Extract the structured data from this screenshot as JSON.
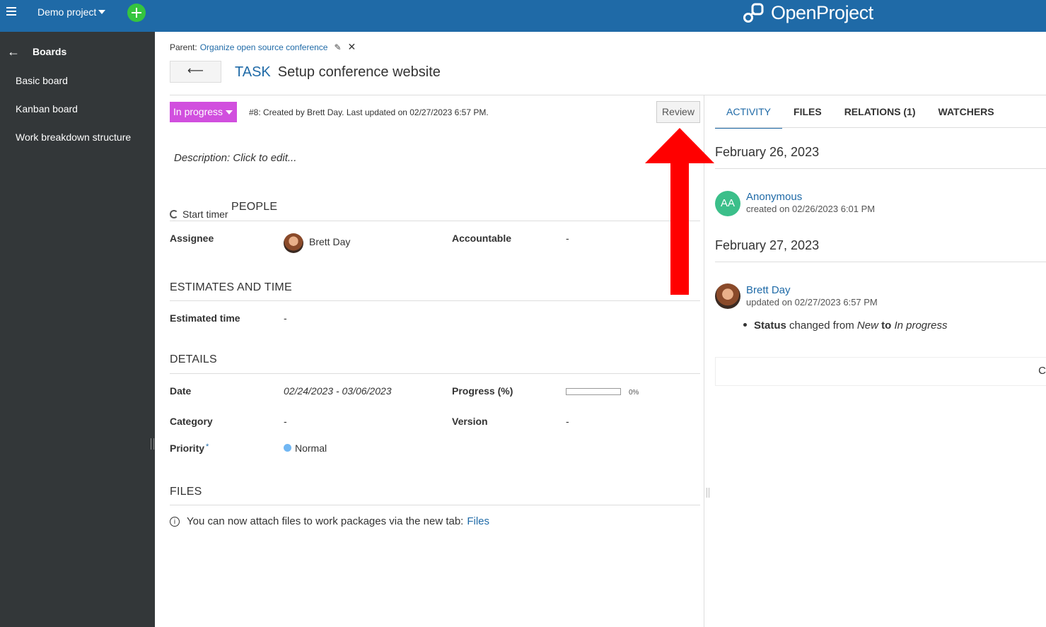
{
  "header": {
    "project_name": "Demo project",
    "logo_text": "OpenProject",
    "accent": "#1f6aa7",
    "plus_color": "#35c53f"
  },
  "sidebar": {
    "back_label": "Boards",
    "items": [
      {
        "label": "Basic board"
      },
      {
        "label": "Kanban board"
      },
      {
        "label": "Work breakdown structure"
      }
    ]
  },
  "work_package": {
    "parent_label": "Parent:",
    "parent_link": "Organize open source conference",
    "type": "TASK",
    "subject": "Setup conference website",
    "status": "In progress",
    "status_color": "#d14fde",
    "meta": "#8: Created by Brett Day. Last updated on 02/27/2023 6:57 PM.",
    "review_label": "Review",
    "description_placeholder": "Description: Click to edit...",
    "start_timer": "Start timer"
  },
  "sections": {
    "people": {
      "title": "PEOPLE",
      "assignee_label": "Assignee",
      "assignee_value": "Brett Day",
      "accountable_label": "Accountable",
      "accountable_value": "-"
    },
    "estimates": {
      "title": "ESTIMATES AND TIME",
      "estimated_label": "Estimated time",
      "estimated_value": "-"
    },
    "details": {
      "title": "DETAILS",
      "date_label": "Date",
      "date_value": "02/24/2023 - 03/06/2023",
      "progress_label": "Progress (%)",
      "progress_value": 0,
      "progress_text": "0%",
      "category_label": "Category",
      "category_value": "-",
      "version_label": "Version",
      "version_value": "-",
      "priority_label": "Priority",
      "priority_required": "*",
      "priority_value": "Normal",
      "priority_color": "#71b7f3"
    },
    "files": {
      "title": "FILES",
      "info_text": "You can now attach files to work packages via the new tab:",
      "files_link": "Files"
    }
  },
  "activity": {
    "tabs": [
      {
        "label": "ACTIVITY"
      },
      {
        "label": "FILES"
      },
      {
        "label": "RELATIONS (1)"
      },
      {
        "label": "WATCHERS"
      }
    ],
    "groups": [
      {
        "date": "February 26, 2023",
        "entries": [
          {
            "initials": "AA",
            "name": "Anonymous",
            "sub": "created on 02/26/2023 6:01 PM"
          }
        ]
      },
      {
        "date": "February 27, 2023",
        "entries": [
          {
            "name": "Brett Day",
            "sub": "updated on 02/27/2023 6:57 PM",
            "detail_field": "Status",
            "detail_changed": "changed from",
            "detail_from": "New",
            "detail_to_word": "to",
            "detail_to": "In progress"
          }
        ]
      }
    ],
    "comment_partial": "C"
  },
  "annotation": {
    "arrow_color": "#ff0000"
  }
}
